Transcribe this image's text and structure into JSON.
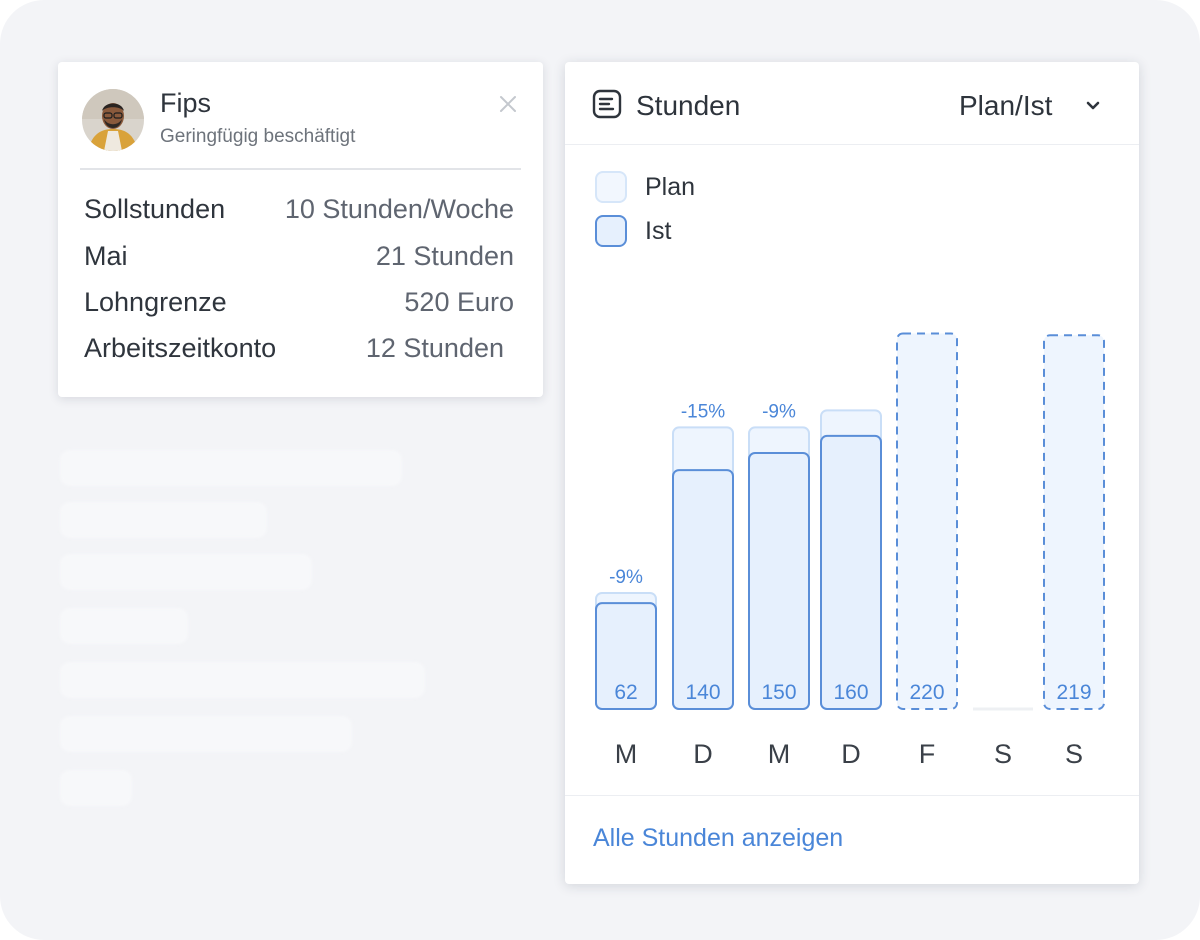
{
  "colors": {
    "accent": "#4a86d8",
    "plan_fill": "#eef5fe",
    "plan_stroke": "#c9def7",
    "ist_fill": "#e6f0fd",
    "ist_stroke": "#5a8ed8"
  },
  "profile": {
    "name": "Fips",
    "role": "Geringfügig beschäftigt",
    "close_icon": "close-icon",
    "rows": [
      {
        "label": "Sollstunden",
        "value": "10 Stunden/Woche"
      },
      {
        "label": "Mai",
        "value": "21 Stunden"
      },
      {
        "label": "Lohngrenze",
        "value": "520 Euro"
      },
      {
        "label": "Arbeitszeitkonto",
        "value": "12 Stunden"
      }
    ]
  },
  "hours": {
    "title": "Stunden",
    "title_icon": "list-icon",
    "view_select": "Plan/Ist",
    "link": "Alle Stunden anzeigen",
    "legend": {
      "plan": "Plan",
      "ist": "Ist"
    }
  },
  "chart_data": {
    "type": "bar",
    "categories": [
      "M",
      "D",
      "M",
      "D",
      "F",
      "S",
      "S"
    ],
    "series": [
      {
        "name": "Plan",
        "values": [
          68,
          165,
          165,
          175,
          220,
          null,
          219
        ]
      },
      {
        "name": "Ist",
        "values": [
          62,
          140,
          150,
          160,
          220,
          null,
          219
        ]
      }
    ],
    "data_labels": [
      "62",
      "140",
      "150",
      "160",
      "220",
      "",
      "219"
    ],
    "deviation_labels": [
      "-9%",
      "-15%",
      "-9%",
      "",
      "",
      "",
      ""
    ],
    "ist_recorded": [
      true,
      true,
      true,
      true,
      false,
      false,
      false
    ],
    "ylim": [
      0,
      225
    ],
    "grid": false,
    "legend_position": "top-left"
  }
}
